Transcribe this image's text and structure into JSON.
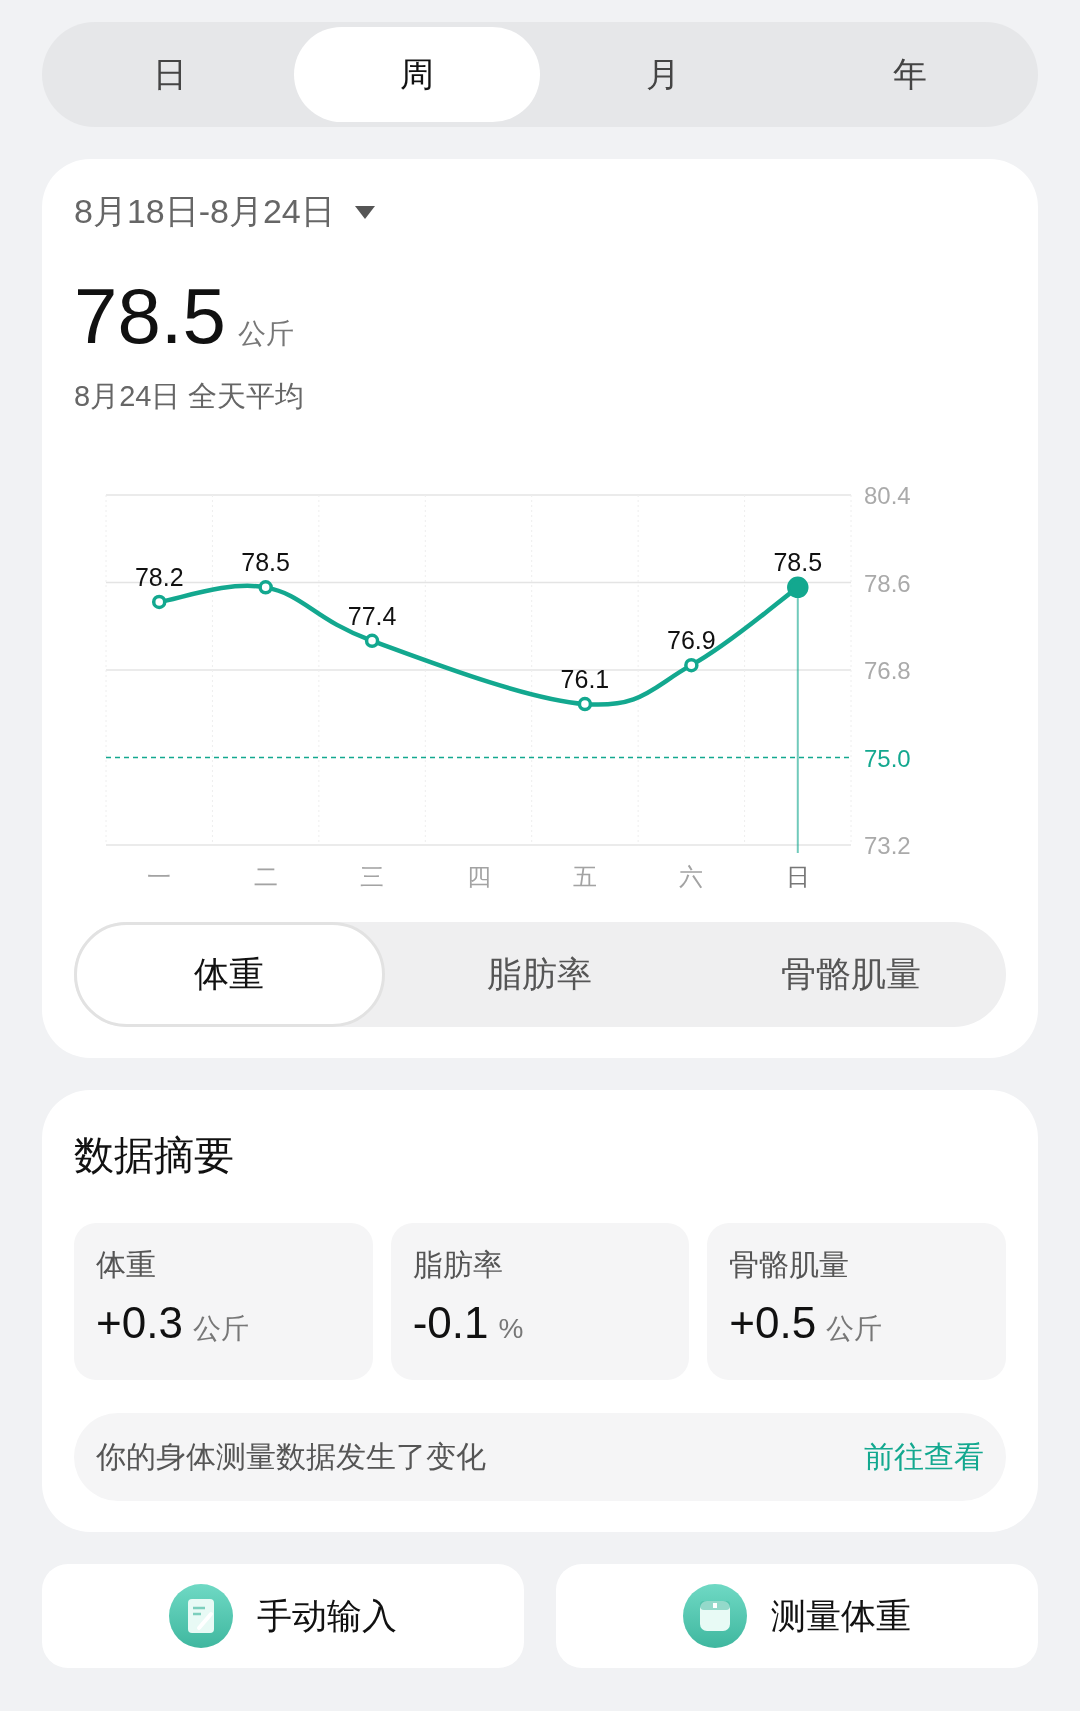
{
  "period_tabs": [
    {
      "label": "日",
      "selected": false
    },
    {
      "label": "周",
      "selected": true
    },
    {
      "label": "月",
      "selected": false
    },
    {
      "label": "年",
      "selected": false
    }
  ],
  "range": {
    "label": "8月18日-8月24日"
  },
  "current": {
    "value": "78.5",
    "unit": "公斤",
    "caption": "8月24日 全天平均"
  },
  "chart_data": {
    "type": "line",
    "categories": [
      "一",
      "二",
      "三",
      "四",
      "五",
      "六",
      "日"
    ],
    "series": [
      {
        "color": "#13a88f",
        "marker": "circle",
        "values": [
          78.2,
          78.5,
          77.4,
          null,
          76.1,
          76.9,
          78.5
        ]
      }
    ],
    "ylim": [
      73.2,
      80.4
    ],
    "yticks": [
      73.2,
      {
        "value": 75.0,
        "label": "75.0"
      },
      76.8,
      78.6,
      80.4
    ],
    "data_labels": true,
    "ref_lines": [
      {
        "axis": "y",
        "value": 75.0
      }
    ]
  },
  "chart_points": [
    {
      "selected": false
    },
    {
      "selected": false
    },
    {
      "selected": false
    },
    {
      "selected": false
    },
    {
      "selected": false
    },
    {
      "selected": false
    },
    {
      "selected": true
    }
  ],
  "metric_tabs": [
    {
      "label": "体重",
      "selected": true
    },
    {
      "label": "脂肪率",
      "selected": false
    },
    {
      "label": "骨骼肌量",
      "selected": false
    }
  ],
  "summary": {
    "title": "数据摘要",
    "stats": [
      {
        "label": "体重",
        "value": "+0.3",
        "unit": "公斤"
      },
      {
        "label": "脂肪率",
        "value": "-0.1",
        "unit": "%"
      },
      {
        "label": "骨骼肌量",
        "value": "+0.5",
        "unit": "公斤"
      }
    ],
    "notice": {
      "text": "你的身体测量数据发生了变化",
      "link": "前往查看"
    }
  },
  "actions": [
    {
      "kind": "manual",
      "label": "手动输入"
    },
    {
      "kind": "scale",
      "label": "测量体重"
    }
  ]
}
